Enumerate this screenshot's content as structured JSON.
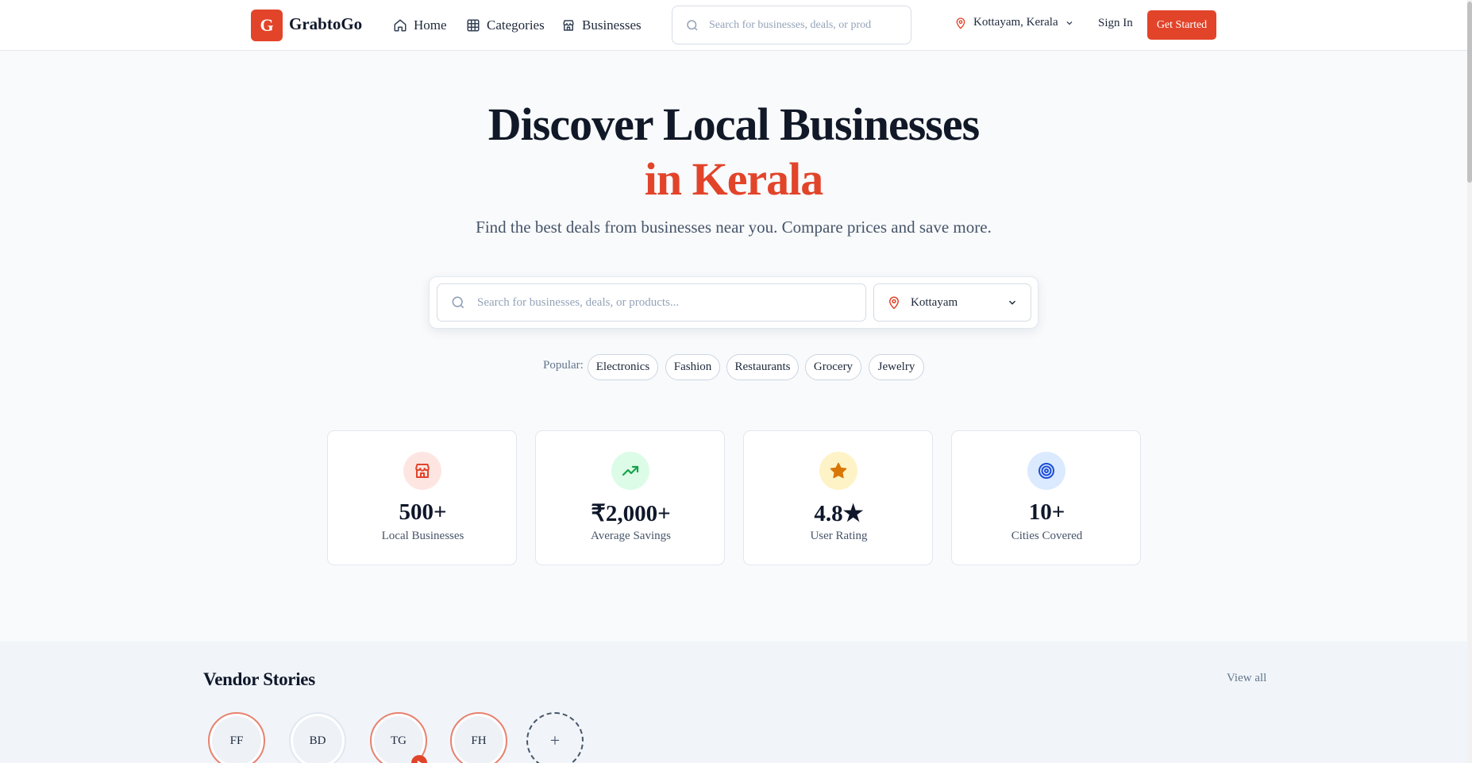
{
  "header": {
    "logo_letter": "G",
    "brand": "GrabtoGo",
    "nav": [
      {
        "label": "Home",
        "icon": "home-icon"
      },
      {
        "label": "Categories",
        "icon": "grid-icon"
      },
      {
        "label": "Businesses",
        "icon": "store-icon"
      }
    ],
    "search_placeholder": "Search for businesses, deals, or prod",
    "location": "Kottayam, Kerala",
    "sign_in": "Sign In",
    "get_started": "Get Started"
  },
  "hero": {
    "title_line1": "Discover Local Businesses",
    "title_line2": "in Kerala",
    "subtitle": "Find the best deals from businesses near you. Compare prices and save more.",
    "search_placeholder": "Search for businesses, deals, or products...",
    "city": "Kottayam",
    "popular_label": "Popular:",
    "popular": [
      "Electronics",
      "Fashion",
      "Restaurants",
      "Grocery",
      "Jewelry"
    ]
  },
  "stats": [
    {
      "value": "500+",
      "label": "Local Businesses",
      "icon": "store-icon",
      "bg": "#fde6e2",
      "color": "#e2442a"
    },
    {
      "value": "₹2,000+",
      "label": "Average Savings",
      "icon": "trending-up-icon",
      "bg": "#dcfce7",
      "color": "#16a34a"
    },
    {
      "value": "4.8★",
      "label": "User Rating",
      "icon": "star-icon",
      "bg": "#fef3c7",
      "color": "#d97706"
    },
    {
      "value": "10+",
      "label": "Cities Covered",
      "icon": "target-icon",
      "bg": "#dbeafe",
      "color": "#1d4ed8"
    }
  ],
  "stories": {
    "title": "Vendor Stories",
    "view_all": "View all",
    "items": [
      {
        "initials": "FF",
        "style": "ring"
      },
      {
        "initials": "BD",
        "style": "plain"
      },
      {
        "initials": "TG",
        "style": "ring",
        "play": true
      },
      {
        "initials": "FH",
        "style": "ring"
      }
    ],
    "add_symbol": "+"
  },
  "colors": {
    "brand": "#e2442a",
    "text": "#0f172a",
    "muted": "#64748b"
  }
}
